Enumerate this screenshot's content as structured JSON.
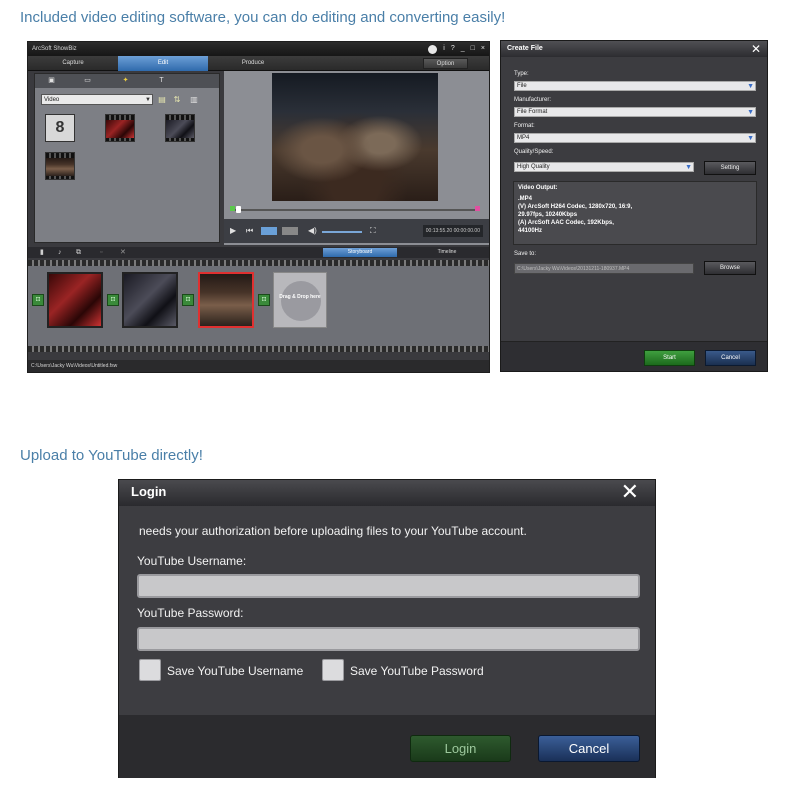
{
  "captions": {
    "editing": "Included video editing software, you can do editing and converting easily!",
    "upload": "Upload to YouTube directly!"
  },
  "showbiz": {
    "title": "ArcSoft ShowBiz",
    "window_controls": [
      "i",
      "?",
      "_",
      "□",
      "×"
    ],
    "tabs": {
      "capture": "Capture",
      "edit": "Edit",
      "produce": "Produce",
      "option": "Option"
    },
    "active_tab": "Edit",
    "library": {
      "dropdown_value": "Video",
      "leader_number": "8",
      "thumbnail_count": 5
    },
    "preview": {
      "timecode": "00:13:55.20  00:00:00.00"
    },
    "storyboard_bar": {
      "storyboard": "Storyboard",
      "timeline": "Timeline"
    },
    "drop_zone": "Drag & Drop here",
    "status_path": "C:\\Users\\Jacky Wu\\Videos\\Untitled.fsw"
  },
  "create_file": {
    "title": "Create File",
    "close": "✕",
    "type_label": "Type:",
    "type_value": "File",
    "manufacturer_label": "Manufacturer:",
    "manufacturer_value": "File Format",
    "format_label": "Format:",
    "format_value": "MP4",
    "quality_label": "Quality/Speed:",
    "quality_value": "High Quality",
    "setting_button": "Setting",
    "output_label": "Video Output:",
    "output_lines": [
      ".MP4",
      "(V) ArcSoft H264 Codec, 1280x720, 16:9,",
      "29.97fps, 10240Kbps",
      "(A) ArcSoft AAC Codec, 192Kbps,",
      "44100Hz"
    ],
    "save_to_label": "Save to:",
    "save_to_value": "C:\\Users\\Jacky Wu\\Videos\\20131211-180937.MP4",
    "browse_button": "Browse",
    "start_button": "Start",
    "cancel_button": "Cancel"
  },
  "login": {
    "title": "Login",
    "close": "✕",
    "message": "needs your authorization before uploading files to your YouTube account.",
    "username_label": "YouTube Username:",
    "username_value": "",
    "password_label": "YouTube Password:",
    "password_value": "",
    "save_username_label": "Save YouTube Username",
    "save_password_label": "Save YouTube Password",
    "login_button": "Login",
    "cancel_button": "Cancel"
  },
  "colors": {
    "caption": "#4a7fa8",
    "accent_blue": "#2f6aac",
    "start_green": "#1c6a1c",
    "cancel_blue": "#1a3058"
  }
}
